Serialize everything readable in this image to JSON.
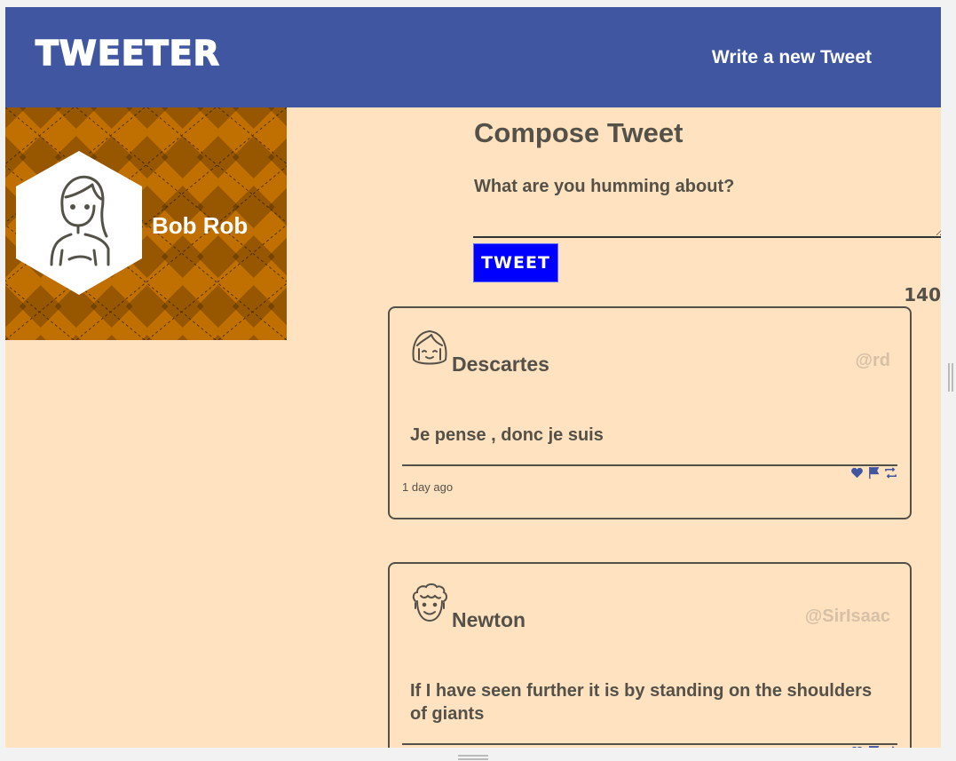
{
  "nav": {
    "brand": "TWEETER",
    "write_link": "Write a new Tweet"
  },
  "profile": {
    "name": "Bob Rob"
  },
  "compose": {
    "title": "Compose Tweet",
    "label": "What are you humming about?",
    "input_value": "",
    "button_label": "TWEET",
    "counter": "140"
  },
  "tweets": [
    {
      "name": "Descartes",
      "handle": "@rd",
      "text": "Je pense , donc je suis",
      "time": "1 day ago",
      "avatar_icon": "girl-face-icon"
    },
    {
      "name": "Newton",
      "handle": "@SirIsaac",
      "text": "If I have seen further it is by standing on the shoulders of giants",
      "time": "",
      "avatar_icon": "curly-hair-face-icon"
    }
  ],
  "colors": {
    "nav_bg": "#4056a1",
    "page_bg": "#ffe2c0",
    "text": "#545149",
    "handle": "#d6c0a6",
    "tweet_button": "#0000ff",
    "profile_pattern": "#c07000",
    "action_icons": "#4056a1"
  }
}
